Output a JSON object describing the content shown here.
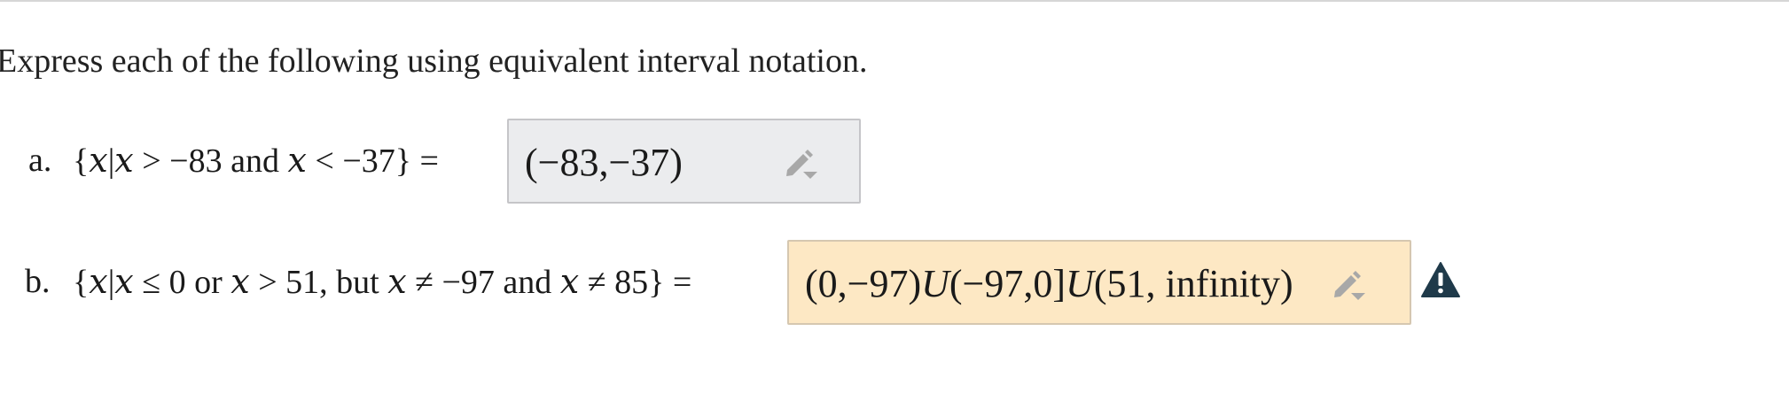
{
  "instructions": "Express each of the following using equivalent interval notation.",
  "problems": [
    {
      "label": "a.",
      "set_parts": {
        "open": "{",
        "var1": "x",
        "bar": "|",
        "var2": "x",
        "rel1": " > −83 ",
        "conj": "and",
        "var3": "x",
        "rel2": " < −37}",
        "eq": " ="
      },
      "answer": "(−83,−37)",
      "answer_state": "neutral",
      "icon": "pencil-edit-dropdown-icon"
    },
    {
      "label": "b.",
      "set_parts": {
        "open": "{",
        "var1": "x",
        "bar": "|",
        "var2": "x",
        "rel1": " ≤ 0 ",
        "conj1": "or",
        "var3": "x",
        "rel2": " > 51, ",
        "conj2": "but",
        "var4": "x",
        "rel3": " ≠ −97 ",
        "conj3": "and",
        "var5": "x",
        "rel4": " ≠ 85}",
        "eq": " ="
      },
      "answer_parts": {
        "p1": "(0,−97)",
        "u1": "U",
        "p2": "(−97,0]",
        "u2": "U",
        "p3": "(51, infinity)"
      },
      "answer_state": "warning",
      "icon": "pencil-edit-dropdown-icon",
      "status_icon": "warning-triangle-icon"
    }
  ],
  "colors": {
    "neutral_box": "#ebecee",
    "warning_box": "#fde8c4",
    "warning_icon": "#1f3a4a"
  }
}
